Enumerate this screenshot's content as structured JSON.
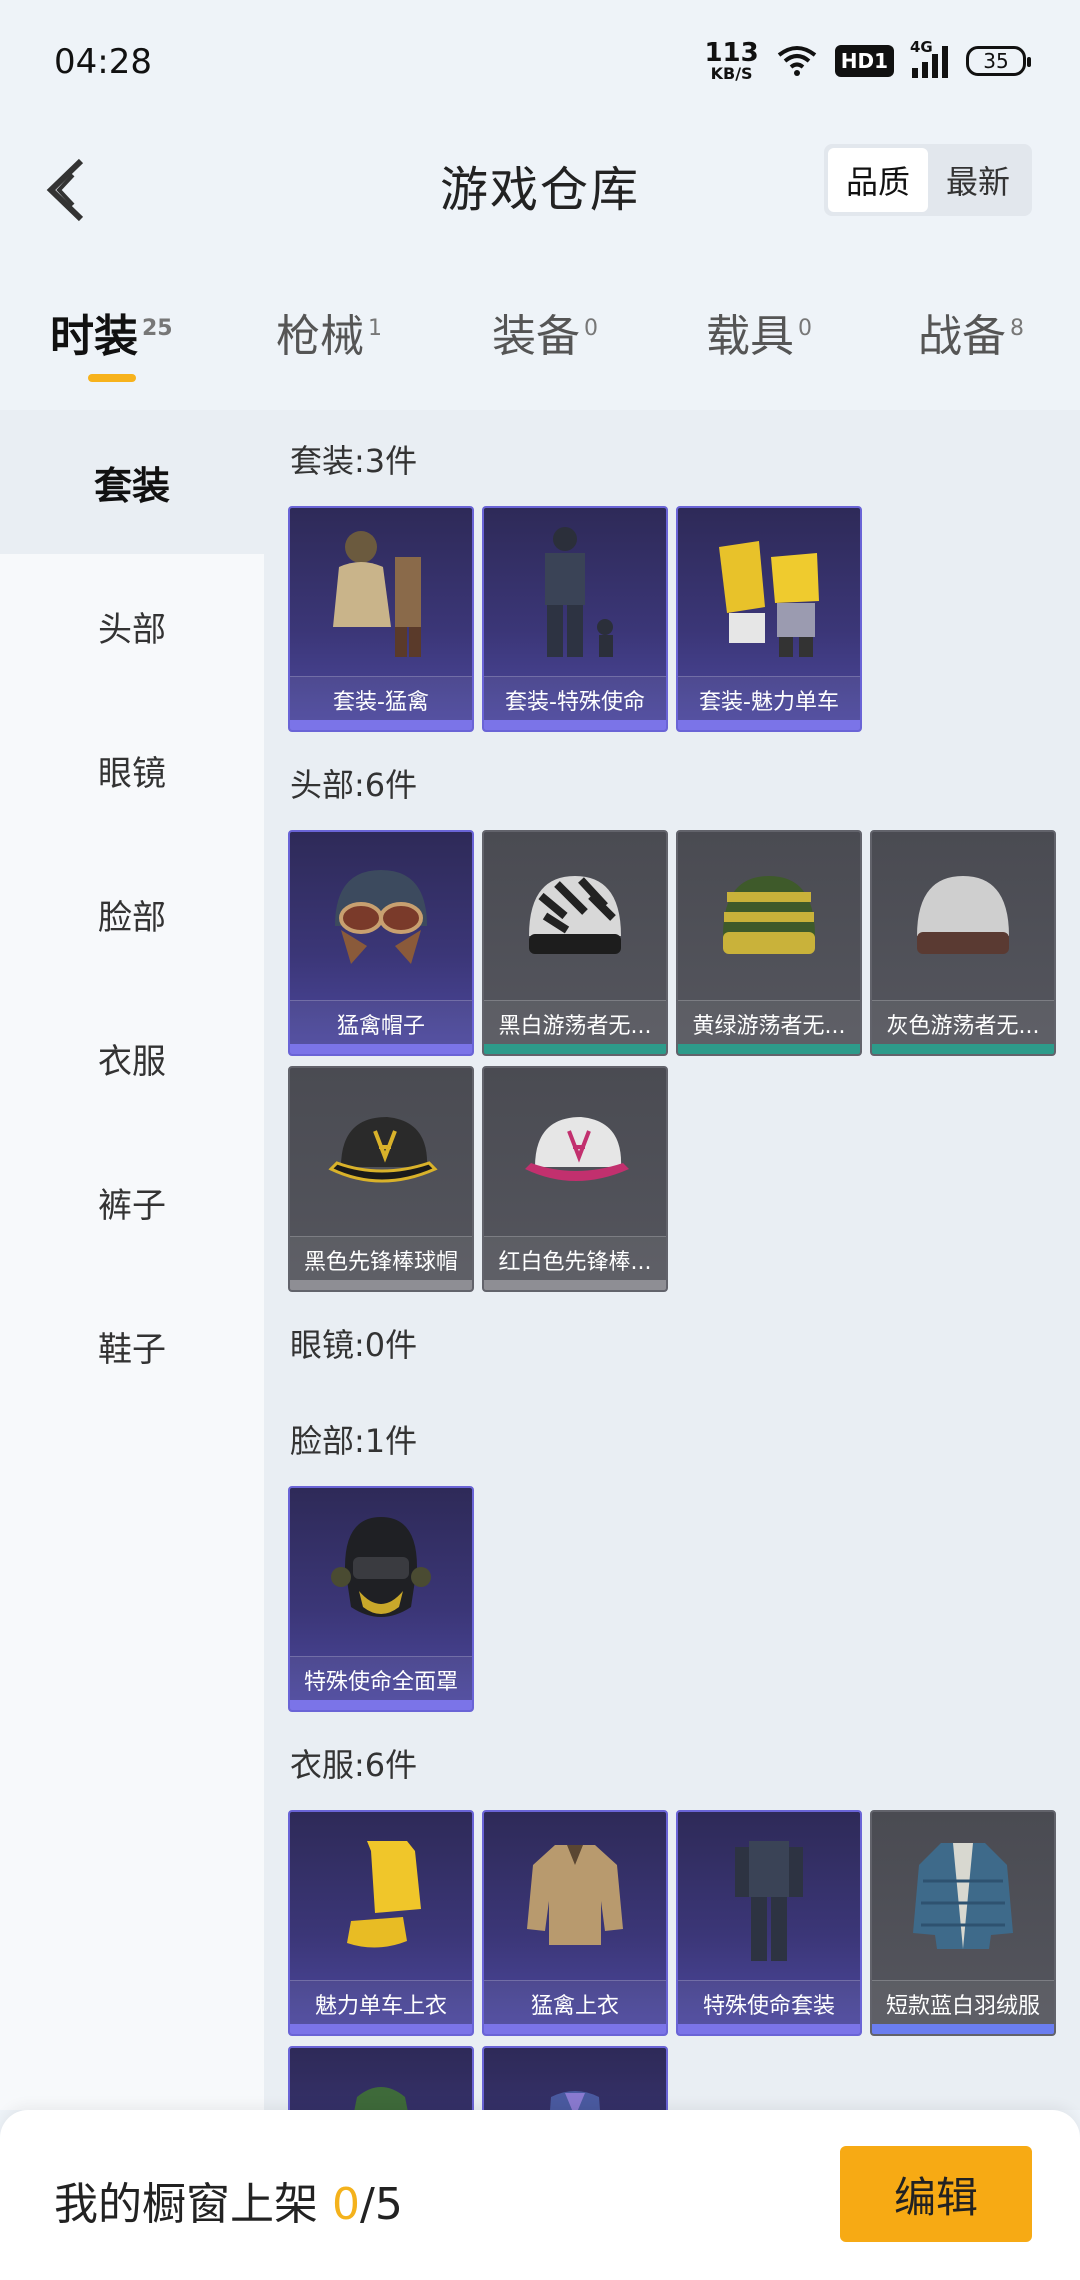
{
  "status": {
    "time": "04:28",
    "net_speed_value": "113",
    "net_speed_unit": "KB/S",
    "hd_label": "HD1",
    "network_label": "4G",
    "battery": "35"
  },
  "header": {
    "title": "游戏仓库",
    "sort_options": [
      "品质",
      "最新"
    ],
    "sort_active": "品质"
  },
  "tabs": [
    {
      "label": "时装",
      "count": "25"
    },
    {
      "label": "枪械",
      "count": "1"
    },
    {
      "label": "装备",
      "count": "0"
    },
    {
      "label": "载具",
      "count": "0"
    },
    {
      "label": "战备",
      "count": "8"
    }
  ],
  "sidebar": {
    "items": [
      "套装",
      "头部",
      "眼镜",
      "脸部",
      "衣服",
      "裤子",
      "鞋子"
    ]
  },
  "sections": {
    "suits": {
      "title": "套装:3件",
      "items": [
        "套装-猛禽",
        "套装-特殊使命",
        "套装-魅力单车"
      ]
    },
    "head": {
      "title": "头部:6件",
      "items": [
        "猛禽帽子",
        "黑白游荡者无...",
        "黄绿游荡者无...",
        "灰色游荡者无...",
        "黑色先锋棒球帽",
        "红白色先锋棒..."
      ]
    },
    "glasses": {
      "title": "眼镜:0件"
    },
    "face": {
      "title": "脸部:1件",
      "items": [
        "特殊使命全面罩"
      ]
    },
    "clothes": {
      "title": "衣服:6件",
      "items": [
        "魅力单车上衣",
        "猛禽上衣",
        "特殊使命套装",
        "短款蓝白羽绒服"
      ]
    }
  },
  "bottom": {
    "shelf_label": "我的橱窗上架",
    "shelf_current": "0",
    "shelf_total": "/5",
    "edit_label": "编辑"
  },
  "colors": {
    "accent": "#f7aa14",
    "purple_rarity": "#7b74e8",
    "teal_rarity": "#2d9b8a"
  }
}
